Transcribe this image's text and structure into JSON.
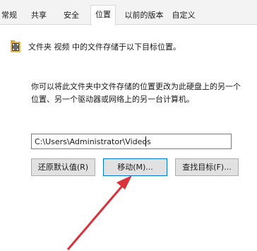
{
  "tabs": [
    "常规",
    "共享",
    "安全",
    "位置",
    "以前的版本",
    "自定义"
  ],
  "active_tab": "位置",
  "folder_label": "文件夹 视频 中的文件存储于以下目标位置。",
  "description_lines": [
    "你可以将此文件夹中文件存储的位置更改为此硬盘上的另一个",
    "位置、另一个驱动器或网络上的另一台计算机。"
  ],
  "path_value": "C:\\Users\\Administrator\\Videos",
  "buttons": {
    "restore": "还原默认值(R)",
    "move": "移动(M)...",
    "find": "查找目标(F)..."
  },
  "icons": {
    "folder": "folder-icon",
    "arrow": "red-arrow-annotation"
  },
  "colors": {
    "arrow": "#d9323a",
    "focus_border": "#0078d7"
  }
}
